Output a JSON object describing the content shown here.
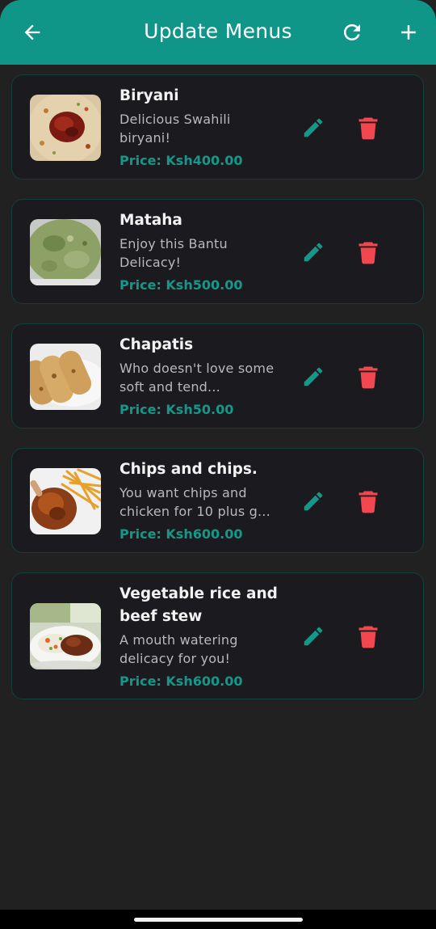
{
  "app_bar": {
    "title": "Update Menus",
    "back_icon": "arrow-left-icon",
    "refresh_icon": "refresh-icon",
    "add_icon": "plus-icon"
  },
  "colors": {
    "accent": "#0f9688",
    "price": "#13988a",
    "delete": "#f2474f",
    "background": "#212121",
    "card": "#1b1a1f"
  },
  "menus": [
    {
      "name": "Biryani",
      "description": "Delicious Swahili biryani!",
      "price": "Price: Ksh400.00"
    },
    {
      "name": "Mataha",
      "description": "Enjoy this Bantu Delicacy!",
      "price": "Price: Ksh500.00"
    },
    {
      "name": "Chapatis",
      "description": "Who doesn't love some soft and tend...",
      "price": "Price: Ksh50.00"
    },
    {
      "name": "Chips and chips.",
      "description": "You want chips and chicken for 10 plus g...",
      "price": "Price: Ksh600.00"
    },
    {
      "name": "Vegetable rice and beef stew",
      "description": "A mouth watering delicacy for you!",
      "price": "Price: Ksh600.00"
    }
  ]
}
